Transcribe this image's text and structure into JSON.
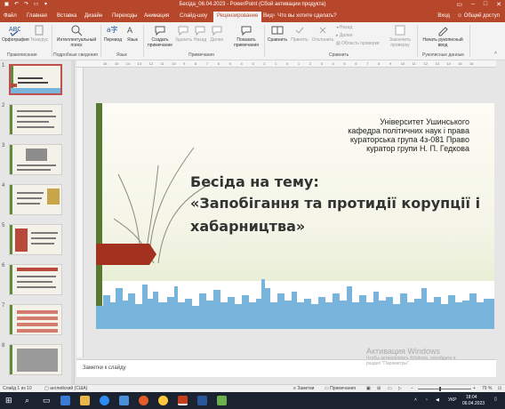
{
  "window": {
    "title": "Бесіда_06.04.2023 - PowerPoint (Сбой активации продукта)",
    "user": "Вход",
    "share": "Общий доступ"
  },
  "tabs": [
    "Файл",
    "Главная",
    "Вставка",
    "Дизайн",
    "Переходы",
    "Анимация",
    "Слайд-шоу",
    "Рецензирование",
    "Вид"
  ],
  "active_tab": "Рецензирование",
  "tell_me": "Что вы хотите сделать?",
  "ribbon": {
    "buttons": {
      "spelling": "Орфография",
      "thesaurus": "Тезаурус",
      "smart_lookup": "Интеллектуальный поиск",
      "translate": "Перевод",
      "language": "Язык",
      "new_comment": "Создать примечание",
      "delete": "Удалить",
      "prev": "Назад",
      "next": "Далее",
      "show_comments": "Показать примечания",
      "compare": "Сравнить",
      "accept": "Принять",
      "reject": "Отклонить",
      "prev_change": "Назад",
      "next_change": "Далее",
      "reviewing_pane": "Область проверки",
      "end_review": "Закончить проверку",
      "start_inking": "Начать рукописный ввод"
    },
    "groups": {
      "proofing": "Правописание",
      "insights": "Подробные сведения",
      "language": "Язык",
      "comments": "Примечания",
      "compare": "Сравнить",
      "ink": "Рукописные данные"
    }
  },
  "ruler": {
    "ticks": [
      "16",
      "15",
      "14",
      "13",
      "12",
      "11",
      "10",
      "9",
      "8",
      "7",
      "6",
      "5",
      "4",
      "3",
      "2",
      "1",
      "0",
      "1",
      "2",
      "3",
      "4",
      "5",
      "6",
      "7",
      "8",
      "9",
      "10",
      "11",
      "12",
      "13",
      "14",
      "15",
      "16"
    ]
  },
  "slide": {
    "credits": [
      "Університет Ушинського",
      "кафедра політичних наук і права",
      "кураторська група 4з-081 Право",
      "куратор групи Н. П. Гедкова"
    ],
    "heading": [
      "Бесіда на тему:",
      "«Запобігання та протидії корупції і",
      "хабарництва»"
    ]
  },
  "thumbnails": [
    "1",
    "2",
    "3",
    "4",
    "5",
    "6",
    "7",
    "8"
  ],
  "notes_placeholder": "Заметки к слайду",
  "watermark": {
    "title": "Активация Windows",
    "line1": "Чтобы активировать Windows, перейдите в",
    "line2": "раздел \"Параметры\"."
  },
  "status": {
    "slide_of": "Слайд 1 из 10",
    "language": "английский (США)",
    "notes": "Заметки",
    "comments": "Примечания",
    "zoom": "79 %",
    "zoom_level": 0.79
  },
  "taskbar": {
    "lang": "УКР",
    "time": "18:04",
    "date": "06.04.2023"
  },
  "colors": {
    "accent": "#b7472a",
    "slide_green": "#58792e",
    "slide_red": "#a3311f",
    "city_blue": "#79b4dd"
  }
}
